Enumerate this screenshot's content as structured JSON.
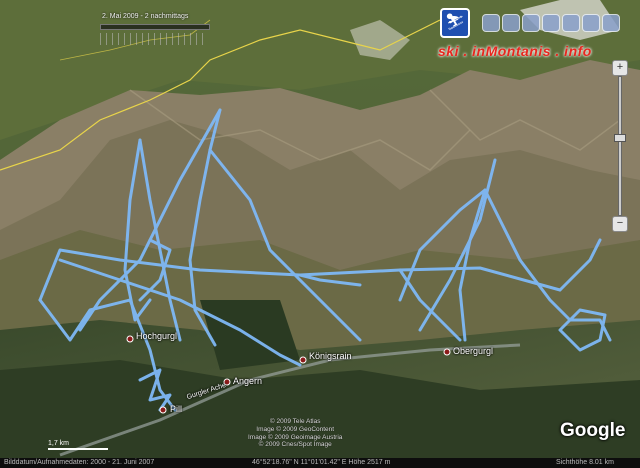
{
  "timeline": {
    "label": "2. Mai 2009 - 2 nachmittags"
  },
  "site": {
    "label": "ski . inMontanis . info"
  },
  "places": [
    {
      "name": "Hochgurgl"
    },
    {
      "name": "Königsrain"
    },
    {
      "name": "Obergurgl"
    },
    {
      "name": "Angern"
    },
    {
      "name": "Pill"
    },
    {
      "name": "Gurgler Ache"
    }
  ],
  "copyright": {
    "lines": [
      "© 2009 Tele Atlas",
      "Image © 2009 GeoContent",
      "Image © 2009 Geoimage Austria",
      "© 2009 Cnes/Spot Image"
    ]
  },
  "scale": {
    "label": "1,7 km"
  },
  "google": {
    "label": "Google"
  },
  "status": {
    "imagery_date": "Bilddatum/Aufnahmedaten: 2000 - 21. Juni 2007",
    "coords": "46°52'18.76\" N    11°01'01.42\" E  Höhe 2517 m",
    "eye": "Sichthöhe    8.01 km"
  },
  "colors": {
    "track": "#7fb8f5",
    "border": "#e8d44a",
    "place_dot": "#8b1a1a"
  },
  "icons": [
    "ski-logo-icon",
    "navigation-icon",
    "zoom-in-icon",
    "zoom-out-icon"
  ]
}
